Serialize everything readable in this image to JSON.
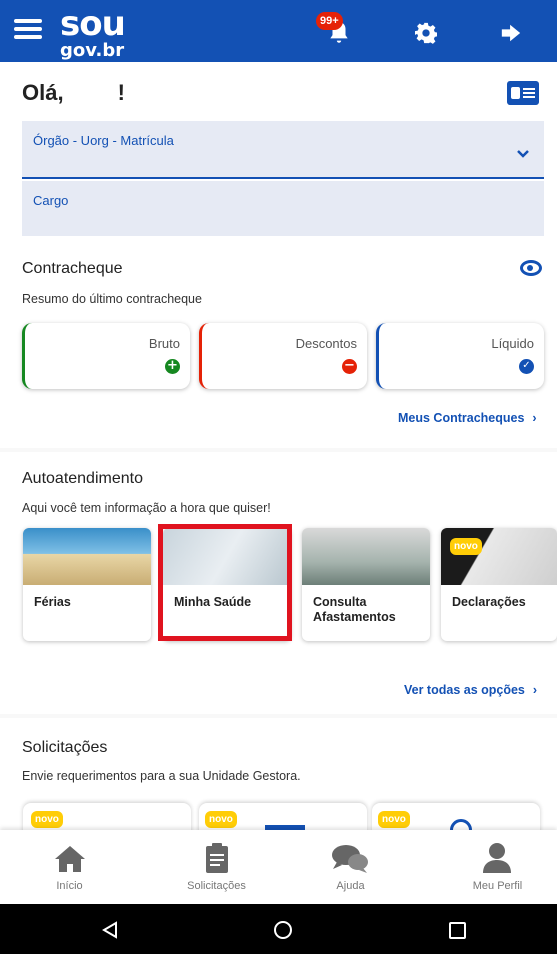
{
  "header": {
    "logo_top": "sou",
    "logo_bottom": "gov.br",
    "notifications_badge": "99+"
  },
  "greeting": {
    "label": "Olá,",
    "exclaim": "!"
  },
  "fields": {
    "org_label": "Órgão - Uorg - Matrícula",
    "cargo_label": "Cargo"
  },
  "contracheque": {
    "title": "Contracheque",
    "subtitle": "Resumo do último contracheque",
    "cards": [
      {
        "label": "Bruto",
        "color": "#168821"
      },
      {
        "label": "Descontos",
        "color": "#e52207"
      },
      {
        "label": "Líquido",
        "color": "#1351b4"
      }
    ],
    "link": "Meus Contracheques"
  },
  "autoatendimento": {
    "title": "Autoatendimento",
    "subtitle": "Aqui você tem informação a hora que quiser!",
    "tiles": [
      "Férias",
      "Minha Saúde",
      "Consulta Afastamentos",
      "Declarações"
    ],
    "novo": "novo",
    "link": "Ver todas as opções"
  },
  "solicitacoes": {
    "title": "Solicitações",
    "subtitle": "Envie requerimentos para a sua Unidade Gestora.",
    "novo": "novo"
  },
  "bottom_nav": [
    {
      "label": "Início",
      "icon": "home-icon"
    },
    {
      "label": "Solicitações",
      "icon": "clipboard-icon"
    },
    {
      "label": "Ajuda",
      "icon": "chat-icon"
    },
    {
      "label": "Meu Perfil",
      "icon": "user-icon"
    }
  ],
  "system_nav": [
    "back-icon",
    "home-circle-icon",
    "recents-icon"
  ]
}
